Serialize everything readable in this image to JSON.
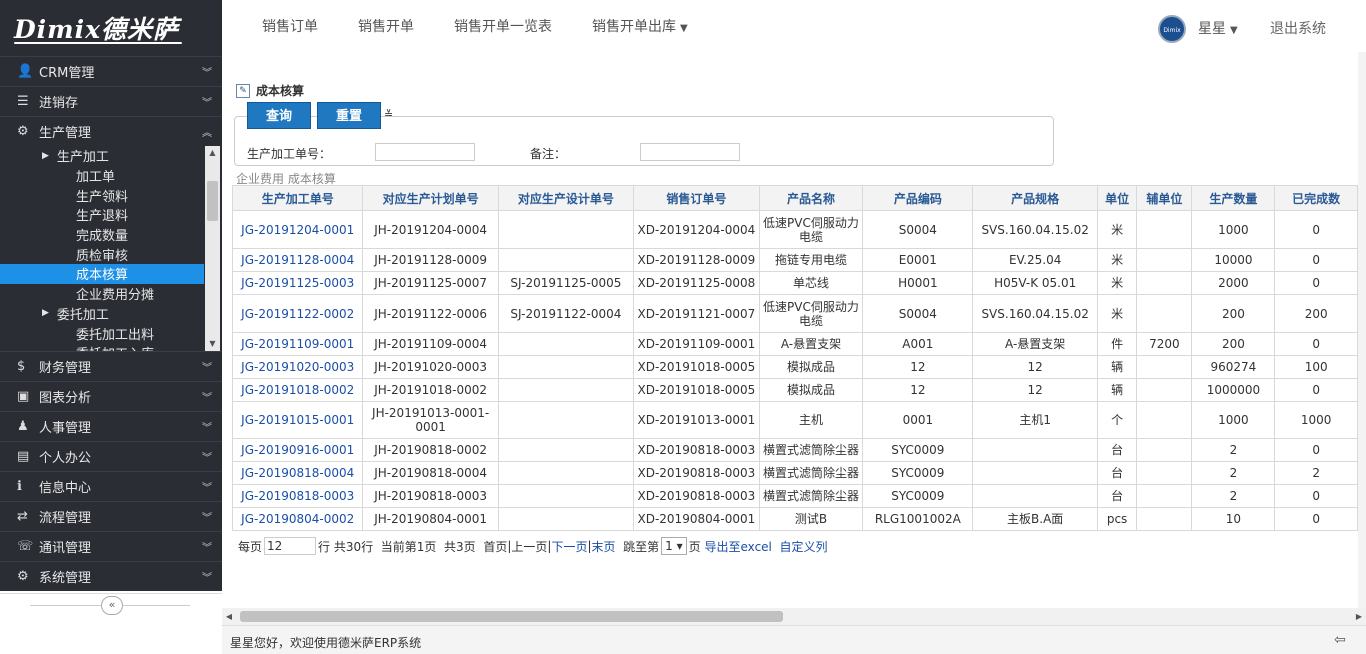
{
  "brand": {
    "logo": "Dimix德米萨"
  },
  "topnav": {
    "items": [
      "销售订单",
      "销售开单",
      "销售开单一览表",
      "销售开单出库"
    ],
    "user": "星星",
    "logout": "退出系统",
    "avatar_text": "Dimix 德米萨"
  },
  "sidebar": {
    "items_top": [
      {
        "icon": "👤",
        "label": "CRM管理"
      },
      {
        "icon": "☰",
        "label": "进销存"
      },
      {
        "icon": "⚙",
        "label": "生产管理"
      }
    ],
    "submenu": [
      {
        "kind": "group",
        "label": "生产加工"
      },
      {
        "kind": "leaf",
        "label": "加工单"
      },
      {
        "kind": "leaf",
        "label": "生产领料"
      },
      {
        "kind": "leaf",
        "label": "生产退料"
      },
      {
        "kind": "leaf",
        "label": "完成数量"
      },
      {
        "kind": "leaf",
        "label": "质检审核"
      },
      {
        "kind": "leaf",
        "label": "成本核算",
        "selected": true
      },
      {
        "kind": "leaf",
        "label": "企业费用分摊"
      },
      {
        "kind": "group",
        "label": "委托加工"
      },
      {
        "kind": "leaf",
        "label": "委托加工出料"
      },
      {
        "kind": "leaf",
        "label": "委托加工入库"
      }
    ],
    "items_bottom": [
      {
        "icon": "$",
        "label": "财务管理"
      },
      {
        "icon": "▣",
        "label": "图表分析"
      },
      {
        "icon": "♟",
        "label": "人事管理"
      },
      {
        "icon": "▤",
        "label": "个人办公"
      },
      {
        "icon": "ℹ",
        "label": "信息中心"
      },
      {
        "icon": "⇄",
        "label": "流程管理"
      },
      {
        "icon": "☏",
        "label": "通讯管理"
      },
      {
        "icon": "⚙",
        "label": "系统管理"
      }
    ]
  },
  "page": {
    "title": "成本核算",
    "btn_query": "查询",
    "btn_reset": "重置",
    "filter": {
      "label1": "生产加工单号：",
      "label2": "备注："
    },
    "breadcrumb": "企业费用 成本核算"
  },
  "table": {
    "headers": [
      "生产加工单号",
      "对应生产计划单号",
      "对应生产设计单号",
      "销售订单号",
      "产品名称",
      "产品编码",
      "产品规格",
      "单位",
      "辅单位",
      "生产数量",
      "已完成数"
    ],
    "rows": [
      [
        "JG-20191204-0001",
        "JH-20191204-0004",
        "",
        "XD-20191204-0004",
        "低速PVC伺服动力电缆",
        "S0004",
        "SVS.160.04.15.02",
        "米",
        "",
        "1000",
        "0"
      ],
      [
        "JG-20191128-0004",
        "JH-20191128-0009",
        "",
        "XD-20191128-0009",
        "拖链专用电缆",
        "E0001",
        "EV.25.04",
        "米",
        "",
        "10000",
        "0"
      ],
      [
        "JG-20191125-0003",
        "JH-20191125-0007",
        "SJ-20191125-0005",
        "XD-20191125-0008",
        "单芯线",
        "H0001",
        "H05V-K 05.01",
        "米",
        "",
        "2000",
        "0"
      ],
      [
        "JG-20191122-0002",
        "JH-20191122-0006",
        "SJ-20191122-0004",
        "XD-20191121-0007",
        "低速PVC伺服动力电缆",
        "S0004",
        "SVS.160.04.15.02",
        "米",
        "",
        "200",
        "200"
      ],
      [
        "JG-20191109-0001",
        "JH-20191109-0004",
        "",
        "XD-20191109-0001",
        "A-悬置支架",
        "A001",
        "A-悬置支架",
        "件",
        "7200",
        "200",
        "0"
      ],
      [
        "JG-20191020-0003",
        "JH-20191020-0003",
        "",
        "XD-20191018-0005",
        "模拟成品",
        "12",
        "12",
        "辆",
        "",
        "960274",
        "100"
      ],
      [
        "JG-20191018-0002",
        "JH-20191018-0002",
        "",
        "XD-20191018-0005",
        "模拟成品",
        "12",
        "12",
        "辆",
        "",
        "1000000",
        "0"
      ],
      [
        "JG-20191015-0001",
        "JH-20191013-0001-0001",
        "",
        "XD-20191013-0001",
        "主机",
        "0001",
        "主机1",
        "个",
        "",
        "1000",
        "1000"
      ],
      [
        "JG-20190916-0001",
        "JH-20190818-0002",
        "",
        "XD-20190818-0003",
        "横置式滤筒除尘器",
        "SYC0009",
        "",
        "台",
        "",
        "2",
        "0"
      ],
      [
        "JG-20190818-0004",
        "JH-20190818-0004",
        "",
        "XD-20190818-0003",
        "横置式滤筒除尘器",
        "SYC0009",
        "",
        "台",
        "",
        "2",
        "2"
      ],
      [
        "JG-20190818-0003",
        "JH-20190818-0003",
        "",
        "XD-20190818-0003",
        "横置式滤筒除尘器",
        "SYC0009",
        "",
        "台",
        "",
        "2",
        "0"
      ],
      [
        "JG-20190804-0002",
        "JH-20190804-0001",
        "",
        "XD-20190804-0001",
        "测试B",
        "RLG1001002A",
        "主板B.A面",
        "pcs",
        "",
        "10",
        "0"
      ]
    ]
  },
  "pager": {
    "per_page_label": "每页",
    "per_page": "12",
    "total": "行 共30行",
    "current": "当前第1页",
    "pages": "共3页",
    "first": "首页",
    "prev": "上一页",
    "next": "下一页",
    "last": "末页",
    "jump_label": "跳至第",
    "jump_val": "1 ▾",
    "page_unit": "页",
    "export": "导出至excel",
    "custom": "自定义列"
  },
  "footer": {
    "welcome": "星星您好，欢迎使用德米萨ERP系统"
  }
}
